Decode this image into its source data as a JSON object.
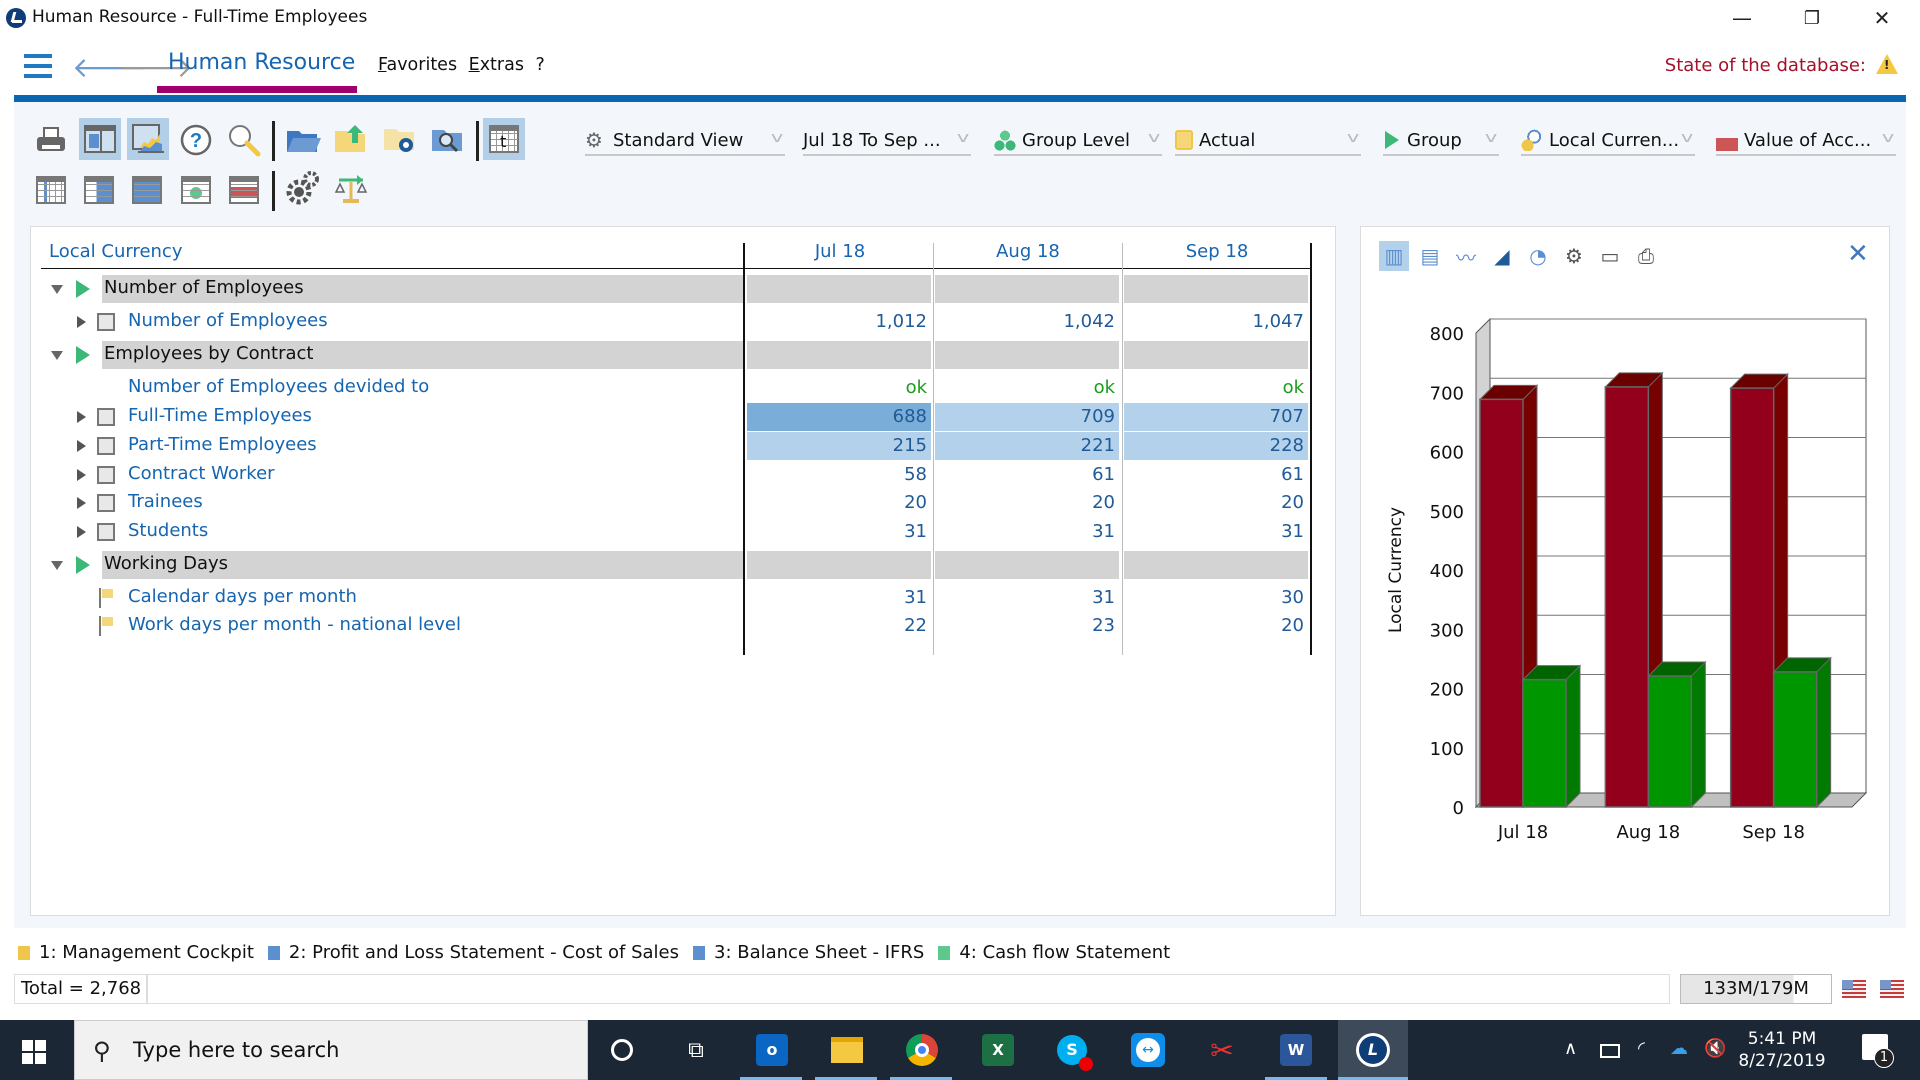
{
  "window": {
    "title": "Human Resource - Full-Time Employees",
    "controls": {
      "minimize": "—",
      "restore": "❐",
      "close": "✕"
    }
  },
  "menubar": {
    "module": "Human Resource",
    "favorites_label": "Favorites",
    "favorites_accel": "F",
    "favorites_rest": "avorites",
    "extras_accel": "E",
    "extras_rest": "xtras",
    "help_label": "?",
    "db_state_label": "State of the database:",
    "accent_color": "#a0006e",
    "bar_color": "#0a66b0"
  },
  "toolbar": {
    "row1": [
      "print-icon",
      "grid-view-icon",
      "chart-view-icon",
      "help-icon",
      "search-icon",
      "open-folder-icon",
      "upload-folder-icon",
      "folder-settings-icon",
      "folder-search-icon",
      "table-t-icon"
    ],
    "row2": [
      "table-column-icon",
      "table-right-icon",
      "table-full-icon",
      "table-cube-icon",
      "table-red-icon",
      "settings-gears-icon",
      "balance-scale-icon"
    ],
    "dropdowns": [
      {
        "label": "Standard View",
        "icon": "gears-icon"
      },
      {
        "label": "Jul 18 To Sep ...",
        "icon": ""
      },
      {
        "label": "Group Level",
        "icon": "cubes-icon"
      },
      {
        "label": "Actual",
        "icon": "cube-icon"
      },
      {
        "label": "Group",
        "icon": "play-icon"
      },
      {
        "label": "Local Curren...",
        "icon": "coins-search-icon"
      },
      {
        "label": "Value of Acc...",
        "icon": "account-search-icon"
      }
    ]
  },
  "grid": {
    "corner_label": "Local Currency",
    "columns": [
      "Jul 18",
      "Aug 18",
      "Sep 18"
    ],
    "rows": [
      {
        "type": "group",
        "label": "Number of Employees",
        "values": [
          "",
          "",
          ""
        ]
      },
      {
        "type": "item",
        "label": "Number of Employees",
        "values": [
          "1,012",
          "1,042",
          "1,047"
        ],
        "marker": "checkbox"
      },
      {
        "type": "group",
        "label": "Employees by Contract",
        "values": [
          "",
          "",
          ""
        ]
      },
      {
        "type": "check",
        "label": "Number of Employees devided to",
        "values": [
          "ok",
          "ok",
          "ok"
        ],
        "marker": "none"
      },
      {
        "type": "item",
        "label": "Full-Time Employees",
        "values": [
          "688",
          "709",
          "707"
        ],
        "marker": "checkbox",
        "highlight": true
      },
      {
        "type": "item",
        "label": "Part-Time Employees",
        "values": [
          "215",
          "221",
          "228"
        ],
        "marker": "checkbox",
        "highlight": true
      },
      {
        "type": "item",
        "label": "Contract Worker",
        "values": [
          "58",
          "61",
          "61"
        ],
        "marker": "checkbox"
      },
      {
        "type": "item",
        "label": "Trainees",
        "values": [
          "20",
          "20",
          "20"
        ],
        "marker": "checkbox"
      },
      {
        "type": "item",
        "label": "Students",
        "values": [
          "31",
          "31",
          "31"
        ],
        "marker": "checkbox"
      },
      {
        "type": "group",
        "label": "Working Days",
        "values": [
          "",
          "",
          ""
        ]
      },
      {
        "type": "flag",
        "label": "Calendar days per month",
        "values": [
          "31",
          "31",
          "30"
        ],
        "marker": "flag"
      },
      {
        "type": "flag",
        "label": "Work days per month - national level",
        "values": [
          "22",
          "23",
          "20"
        ],
        "marker": "flag"
      }
    ]
  },
  "chart_toolbar": [
    "bar-chart-icon",
    "stacked-bar-icon",
    "line-chart-icon",
    "area-chart-icon",
    "pie-chart-icon",
    "chart-settings-icon",
    "new-window-icon",
    "print-icon"
  ],
  "chart_data": {
    "type": "bar",
    "style": "3d-grouped",
    "title": "",
    "xlabel": "",
    "ylabel": "Local Currency",
    "categories": [
      "Jul 18",
      "Aug 18",
      "Sep 18"
    ],
    "series": [
      {
        "name": "Full-Time Employees",
        "values": [
          688,
          709,
          707
        ],
        "color": "#93001c"
      },
      {
        "name": "Part-Time Employees",
        "values": [
          215,
          221,
          228
        ],
        "color": "#009600"
      }
    ],
    "ylim": [
      0,
      800
    ],
    "yticks": [
      0,
      100,
      200,
      300,
      400,
      500,
      600,
      700,
      800
    ],
    "grid": true,
    "legend": "none"
  },
  "report_tabs": [
    {
      "label": "1: Management Cockpit",
      "color": "#f0c64a"
    },
    {
      "label": "2: Profit and Loss Statement - Cost of Sales",
      "color": "#5b8fd0"
    },
    {
      "label": "3: Balance Sheet - IFRS",
      "color": "#5b8fd0"
    },
    {
      "label": "4: Cash flow Statement",
      "color": "#5cc98d"
    }
  ],
  "status": {
    "total": "Total = 2,768",
    "memory": "133M/179M",
    "memory_used_fraction": 0.74
  },
  "taskbar": {
    "search_placeholder": "Type here to search",
    "apps": [
      "cortana-icon",
      "task-view-icon",
      "outlook-icon",
      "file-explorer-icon",
      "chrome-icon",
      "excel-icon",
      "skype-icon",
      "teamviewer-icon",
      "snipping-tool-icon",
      "word-icon",
      "lucanet-icon"
    ],
    "time": "5:41 PM",
    "date": "8/27/2019",
    "notification_count": "1"
  }
}
